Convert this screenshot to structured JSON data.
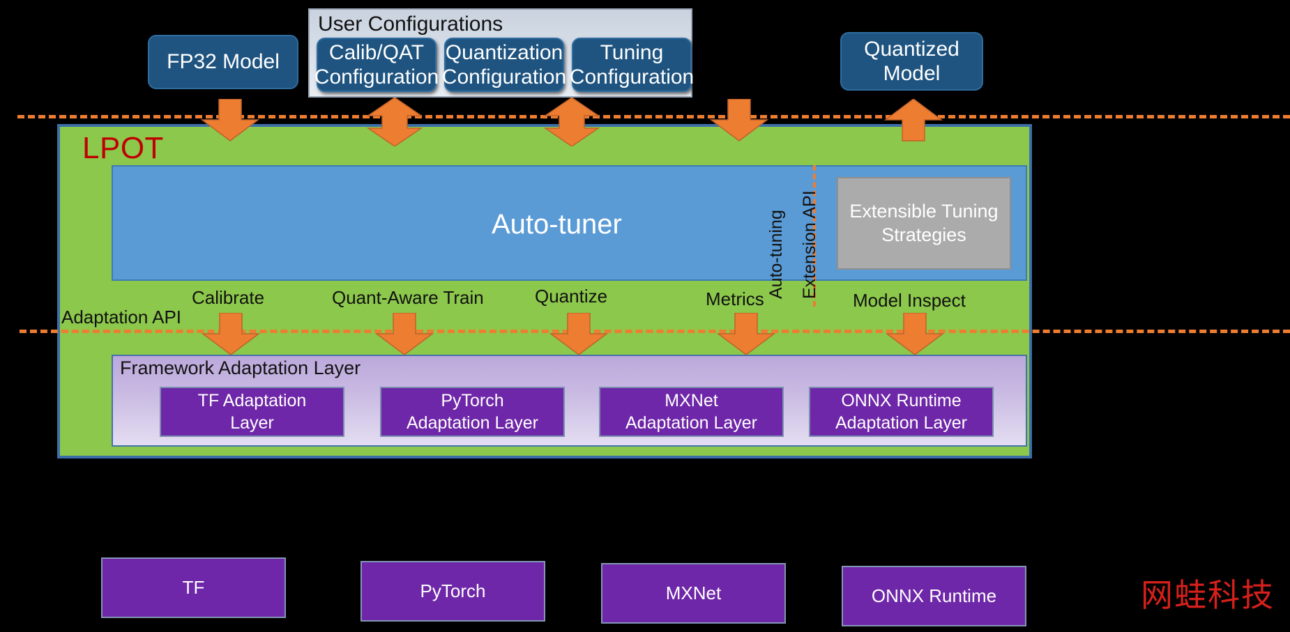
{
  "diagram": {
    "title": "LPOT Architecture",
    "colors": {
      "background": "#000000",
      "navy_box": "#1F5480",
      "lpot_green": "#8CC84B",
      "auto_tuner_blue": "#5B9BD5",
      "strategies_grey": "#ABABAB",
      "purple": "#6E27A8",
      "arrow_orange": "#ED7D31",
      "lpot_label_red": "#C00000",
      "panel_grey": "#D7DEE8",
      "fal_lavender": "#C8B9E2",
      "watermark_red": "#E8231F"
    }
  },
  "top_row": {
    "fp32_model": "FP32 Model",
    "quantized_model": "Quantized\nModel",
    "quantized_model_line1": "Quantized",
    "quantized_model_line2": "Model"
  },
  "user_configurations": {
    "title": "User Configurations",
    "boxes": [
      {
        "line1": "Calib/QAT",
        "line2": "Configuration"
      },
      {
        "line1": "Quantization",
        "line2": "Configuration"
      },
      {
        "line1": "Tuning",
        "line2": "Configuration"
      }
    ]
  },
  "lpot": {
    "label": "LPOT",
    "auto_tuner": "Auto-tuner",
    "extensible_strategies": {
      "line1": "Extensible Tuning",
      "line2": "Strategies"
    },
    "vertical_labels": {
      "auto_tuning": "Auto-tuning",
      "extension_api": "Extension API"
    },
    "adaptation_api_label": "Adaptation API",
    "mid_labels": [
      "Calibrate",
      "Quant-Aware Train",
      "Quantize",
      "Metrics",
      "Model Inspect"
    ]
  },
  "framework_adaptation_layer": {
    "title": "Framework Adaptation Layer",
    "boxes": [
      {
        "line1": "TF Adaptation",
        "line2": "Layer"
      },
      {
        "line1": "PyTorch",
        "line2": "Adaptation Layer"
      },
      {
        "line1": "MXNet",
        "line2": "Adaptation Layer"
      },
      {
        "line1": "ONNX Runtime",
        "line2": "Adaptation Layer"
      }
    ]
  },
  "frameworks": [
    "TF",
    "PyTorch",
    "MXNet",
    "ONNX Runtime"
  ],
  "watermark": {
    "text": "网蛙科技"
  }
}
